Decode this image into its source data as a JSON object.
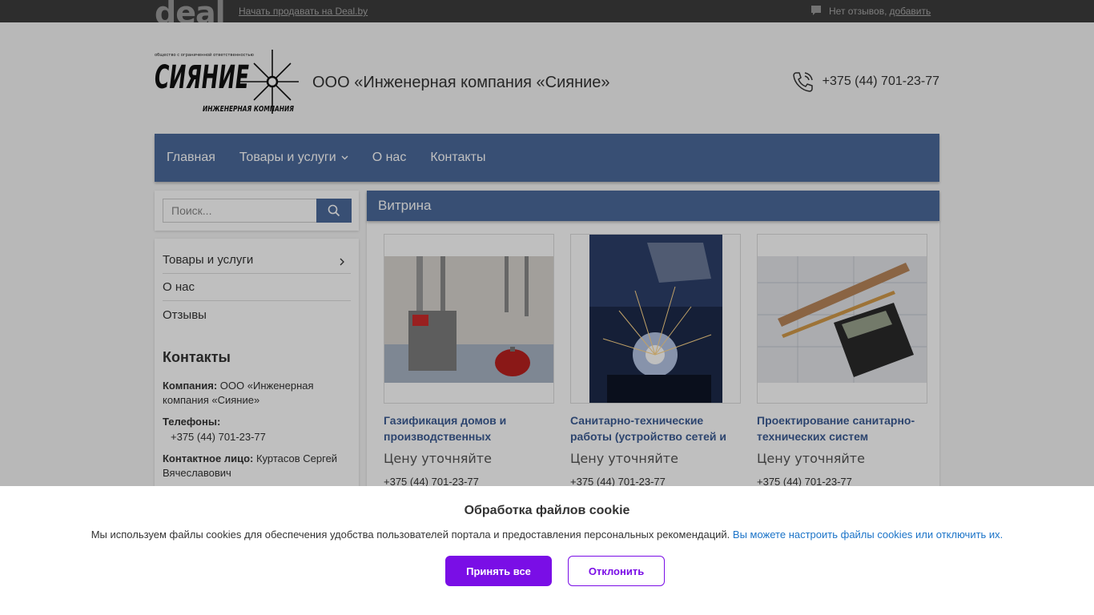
{
  "topbar": {
    "logo_text": "deal",
    "sell_link": "Начать продавать на Deal.by",
    "reviews_text": "Нет отзывов,",
    "reviews_add": "добавить"
  },
  "header": {
    "logo_lines": [
      "общество с ограниченной ответственностью",
      "СИЯНИЕ",
      "ИНЖЕНЕРНАЯ КОМПАНИЯ"
    ],
    "company_name": "ООО «Инженерная компания «Сияние»",
    "phone": "+375 (44) 701-23-77"
  },
  "nav": {
    "items": [
      {
        "label": "Главная"
      },
      {
        "label": "Товары и услуги",
        "has_dropdown": true
      },
      {
        "label": "О нас"
      },
      {
        "label": "Контакты"
      }
    ]
  },
  "search": {
    "placeholder": "Поиск..."
  },
  "sidebar": {
    "menu": [
      {
        "label": "Товары и услуги",
        "has_submenu": true
      },
      {
        "label": "О нас"
      },
      {
        "label": "Отзывы"
      }
    ],
    "contacts_title": "Контакты",
    "company_label": "Компания:",
    "company_value": "ООО «Инженерная компания «Сияние»",
    "phones_label": "Телефоны:",
    "phones_value": "+375 (44) 701-23-77",
    "person_label": "Контактное лицо:",
    "person_value": "Куртасов Сергей Вячеславович"
  },
  "showcase": {
    "title": "Витрина",
    "cards": [
      {
        "title": "Газификация домов и производственных",
        "price": "Цену уточняйте",
        "phone": "+375 (44) 701-23-77"
      },
      {
        "title": "Санитарно-технические работы (устройство сетей и",
        "price": "Цену уточняйте",
        "phone": "+375 (44) 701-23-77"
      },
      {
        "title": "Проектирование санитарно-технических систем",
        "price": "Цену уточняйте",
        "phone": "+375 (44) 701-23-77"
      }
    ]
  },
  "cookie": {
    "title": "Обработка файлов cookie",
    "text": "Мы используем файлы cookies для обеспечения удобства пользователей портала и предоставления персональных рекомендаций.",
    "link": "Вы можете настроить файлы cookies или отключить их.",
    "accept": "Принять все",
    "decline": "Отклонить",
    "accent_color": "#7a0ee6"
  },
  "colors": {
    "nav_bg": "#4b6a9b",
    "topbar_bg": "#3d3d3d",
    "card_title": "#3d5d94"
  }
}
